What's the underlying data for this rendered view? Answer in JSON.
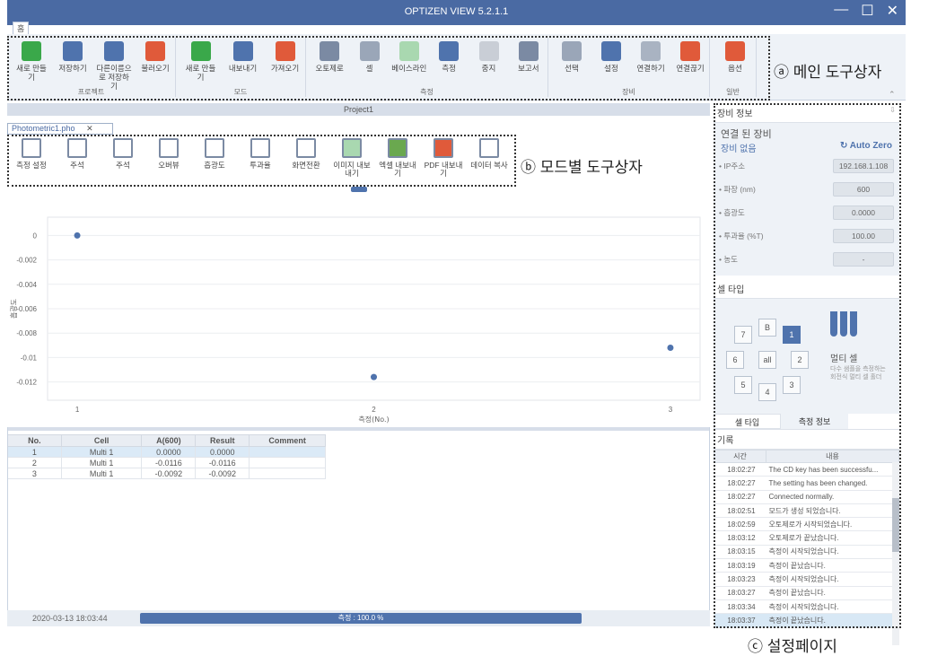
{
  "app": {
    "title": "OPTIZEN VIEW 5.2.1.1",
    "file_tab": "홈",
    "window_controls": [
      "—",
      "☐",
      "✕"
    ]
  },
  "ribbon": {
    "groups": [
      {
        "label": "프로젝트",
        "buttons": [
          {
            "label": "새로 만들기",
            "icon": "new-project-icon",
            "color": "#3aa84a"
          },
          {
            "label": "저장하기",
            "icon": "save-icon",
            "color": "#4f73ad"
          },
          {
            "label": "다른이름으로 저장하기",
            "icon": "save-as-icon",
            "color": "#4f73ad"
          },
          {
            "label": "불러오기",
            "icon": "open-icon",
            "color": "#e05a3a"
          }
        ]
      },
      {
        "label": "모드",
        "buttons": [
          {
            "label": "새로 만들기",
            "icon": "new-mode-icon",
            "color": "#3aa84a"
          },
          {
            "label": "내보내기",
            "icon": "export-icon",
            "color": "#4f73ad"
          },
          {
            "label": "가져오기",
            "icon": "import-icon",
            "color": "#e05a3a"
          }
        ]
      },
      {
        "label": "측정",
        "buttons": [
          {
            "label": "오토제로",
            "icon": "auto-zero-icon",
            "color": "#7b8aa3"
          },
          {
            "label": "셀",
            "icon": "cell-icon",
            "color": "#9aa6b8"
          },
          {
            "label": "베이스라인",
            "icon": "baseline-icon",
            "color": "#a9d8b0"
          },
          {
            "label": "측정",
            "icon": "measure-icon",
            "color": "#4f73ad"
          },
          {
            "label": "중지",
            "icon": "stop-icon",
            "color": "#c9ced6"
          },
          {
            "label": "보고서",
            "icon": "report-icon",
            "color": "#7b8aa3"
          }
        ]
      },
      {
        "label": "장비",
        "buttons": [
          {
            "label": "선택",
            "icon": "select-device-icon",
            "color": "#9aa6b8"
          },
          {
            "label": "설정",
            "icon": "settings-globe-icon",
            "color": "#4f73ad"
          },
          {
            "label": "연결하기",
            "icon": "connect-icon",
            "color": "#a9b3c2"
          },
          {
            "label": "연결끊기",
            "icon": "disconnect-icon",
            "color": "#e05a3a"
          }
        ]
      },
      {
        "label": "일반",
        "buttons": [
          {
            "label": "옵션",
            "icon": "options-icon",
            "color": "#e05a3a"
          }
        ]
      }
    ]
  },
  "annotations": {
    "a": "ⓐ 메인 도구상자",
    "b": "ⓑ 모드별 도구상자",
    "c": "ⓒ 설정페이지"
  },
  "project": {
    "name": "Project1",
    "doc_tab": "Photometric1.pho"
  },
  "mode_toolbar": [
    {
      "label": "측정 설정",
      "icon": "measure-settings-icon"
    },
    {
      "label": "주석",
      "icon": "annotation-icon"
    },
    {
      "label": "주석",
      "icon": "annotation-edit-icon"
    },
    {
      "label": "오버뷰",
      "icon": "overview-icon"
    },
    {
      "label": "흡광도",
      "icon": "absorbance-icon"
    },
    {
      "label": "투과율",
      "icon": "transmittance-icon"
    },
    {
      "label": "화면전환",
      "icon": "switch-view-icon"
    },
    {
      "label": "이미지 내보내기",
      "icon": "image-export-icon"
    },
    {
      "label": "엑셀 내보내기",
      "icon": "excel-export-icon"
    },
    {
      "label": "PDF 내보내기",
      "icon": "pdf-export-icon"
    },
    {
      "label": "데이터 복사",
      "icon": "copy-data-icon"
    }
  ],
  "chart_data": {
    "type": "scatter",
    "x": [
      1,
      2,
      3
    ],
    "y": [
      0.0,
      -0.0116,
      -0.0092
    ],
    "xlabel": "측정(No.)",
    "ylabel": "흡광도",
    "yticks": [
      "0",
      "-0.002",
      "-0.004",
      "-0.006",
      "-0.008",
      "-0.01",
      "-0.012"
    ],
    "xticks": [
      "1",
      "2",
      "3"
    ],
    "ylim": [
      -0.0135,
      0.0015
    ],
    "xlim": [
      0.9,
      3.1
    ],
    "color": "#4f73ad"
  },
  "table": {
    "headers": [
      "No.",
      "Cell",
      "A(600)",
      "Result",
      "Comment"
    ],
    "rows": [
      [
        "1",
        "Multi 1",
        "0.0000",
        "0.0000",
        ""
      ],
      [
        "2",
        "Multi 1",
        "-0.0116",
        "-0.0116",
        ""
      ],
      [
        "3",
        "Multi 1",
        "-0.0092",
        "-0.0092",
        ""
      ]
    ]
  },
  "status": {
    "datetime": "2020-03-13 18:03:44",
    "progress_label": "측정 : 100.0 %",
    "progress": 1.0
  },
  "side": {
    "device_header": "장비 정보",
    "connected_title": "연결 된 장비",
    "device_none": "장비 없음",
    "auto_zero": "Auto Zero",
    "fields": [
      {
        "label": "• IP주소",
        "value": "192.168.1.108"
      },
      {
        "label": "• 파장 (nm)",
        "value": "600"
      },
      {
        "label": "• 흡광도",
        "value": "0.0000"
      },
      {
        "label": "• 투과율 (%T)",
        "value": "100.00"
      },
      {
        "label": "• 농도",
        "value": "-"
      }
    ],
    "cell_header": "셀 타입",
    "cells": [
      "7",
      "B",
      "1",
      "6",
      "all",
      "2",
      "5",
      "4",
      "3"
    ],
    "cell_title": "멀티 셀",
    "cell_desc": "다수 샘플을 측정하는 회전식 멀티 셀 홀더",
    "tabs": [
      "셀 타입",
      "측정 정보"
    ],
    "log_header": "기록",
    "log_cols": [
      "시간",
      "내용"
    ],
    "log": [
      [
        "18:02:27",
        "The CD key has been successfu..."
      ],
      [
        "18:02:27",
        "The setting has been changed."
      ],
      [
        "18:02:27",
        "Connected normally."
      ],
      [
        "18:02:51",
        "모드가 생성 되었습니다."
      ],
      [
        "18:02:59",
        "오토제로가 시작되었습니다."
      ],
      [
        "18:03:12",
        "오토제로가 끝났습니다."
      ],
      [
        "18:03:15",
        "측정이 시작되었습니다."
      ],
      [
        "18:03:19",
        "측정이 끝났습니다."
      ],
      [
        "18:03:23",
        "측정이 시작되었습니다."
      ],
      [
        "18:03:27",
        "측정이 끝났습니다."
      ],
      [
        "18:03:34",
        "측정이 시작되었습니다."
      ],
      [
        "18:03:37",
        "측정이 끝났습니다."
      ]
    ]
  }
}
